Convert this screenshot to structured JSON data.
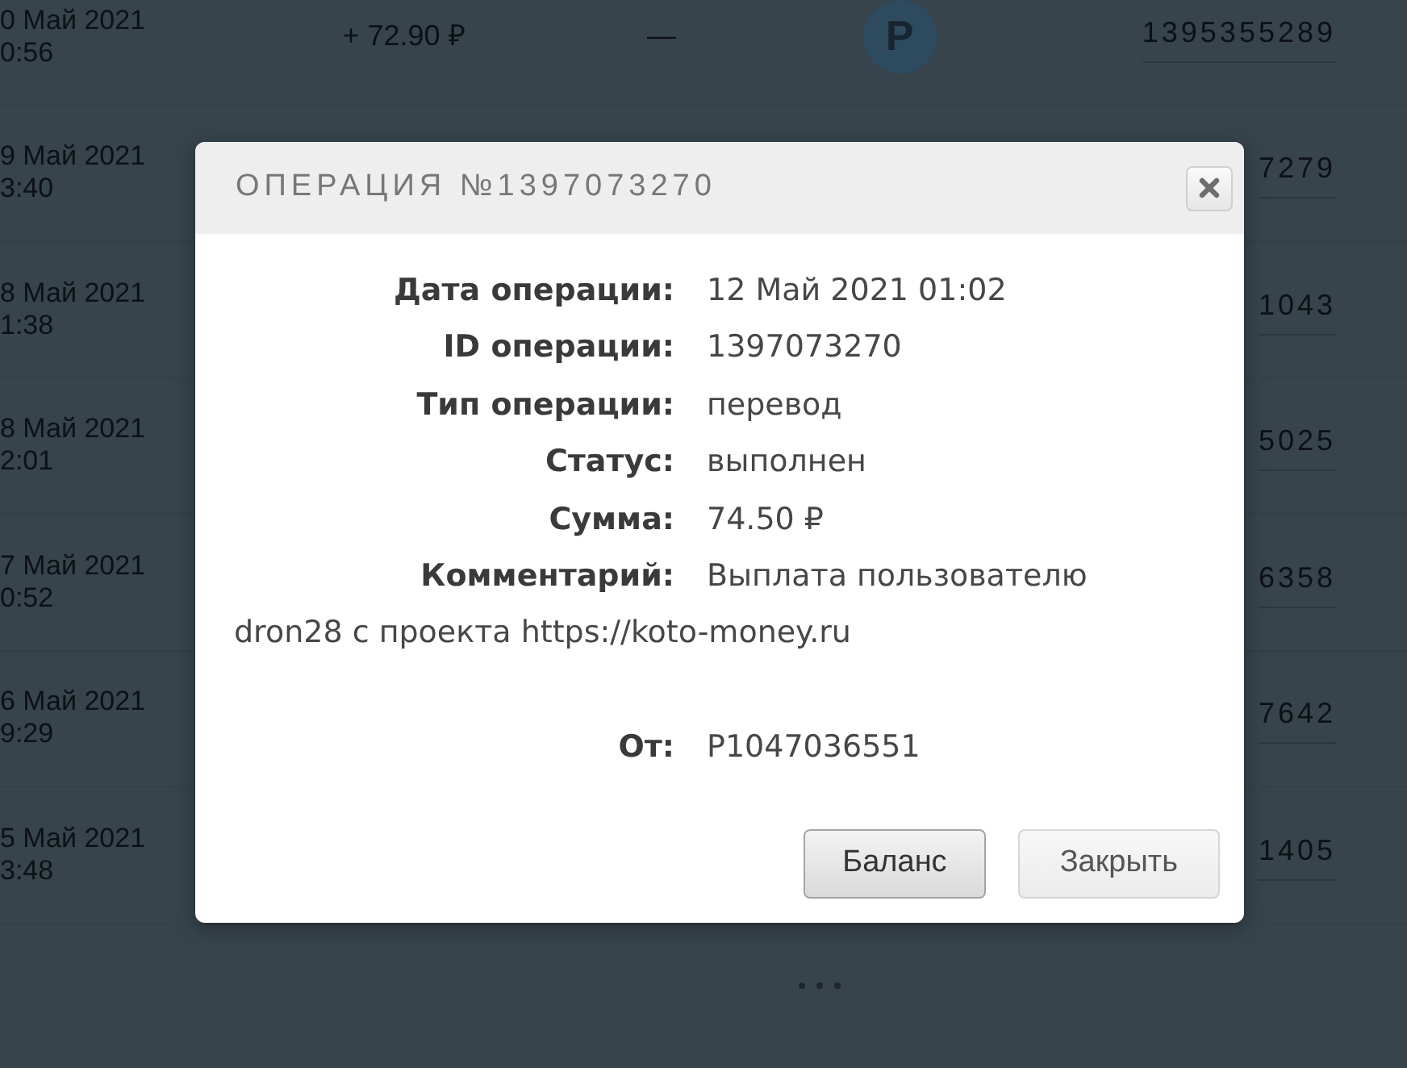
{
  "transactions": [
    {
      "date": "0 Май 2021",
      "time": "0:56",
      "amount": "+ 72.90 ₽",
      "fee": "—",
      "method": "P",
      "operation_id": "1395355289"
    },
    {
      "date": "9 Май 2021",
      "time": "3:40",
      "operation_id": "7279"
    },
    {
      "date": "8 Май 2021",
      "time": "1:38",
      "operation_id": "1043"
    },
    {
      "date": "8 Май 2021",
      "time": "2:01",
      "operation_id": "5025"
    },
    {
      "date": "7 Май 2021",
      "time": "0:52",
      "operation_id": "6358"
    },
    {
      "date": "6 Май 2021",
      "time": "9:29",
      "operation_id": "7642"
    },
    {
      "date": "5 Май 2021",
      "time": "3:48",
      "operation_id": "1405"
    }
  ],
  "modal": {
    "title": "ОПЕРАЦИЯ №1397073270",
    "details": [
      {
        "label": "Дата операции:",
        "value": "12 Май 2021 01:02"
      },
      {
        "label": "ID операции:",
        "value": "1397073270"
      },
      {
        "label": "Тип операции:",
        "value": "перевод"
      },
      {
        "label": "Статус:",
        "value": "выполнен"
      },
      {
        "label": "Сумма:",
        "value": "74.50 ₽"
      },
      {
        "label": "Комментарий:",
        "value": "Выплата пользователю dron28 с проекта https://koto-money.ru"
      },
      {
        "label": "От:",
        "value": "P1047036551"
      }
    ],
    "buttons": [
      {
        "label": "Баланс",
        "kind": "default"
      },
      {
        "label": "Закрыть",
        "kind": "plain"
      }
    ]
  }
}
